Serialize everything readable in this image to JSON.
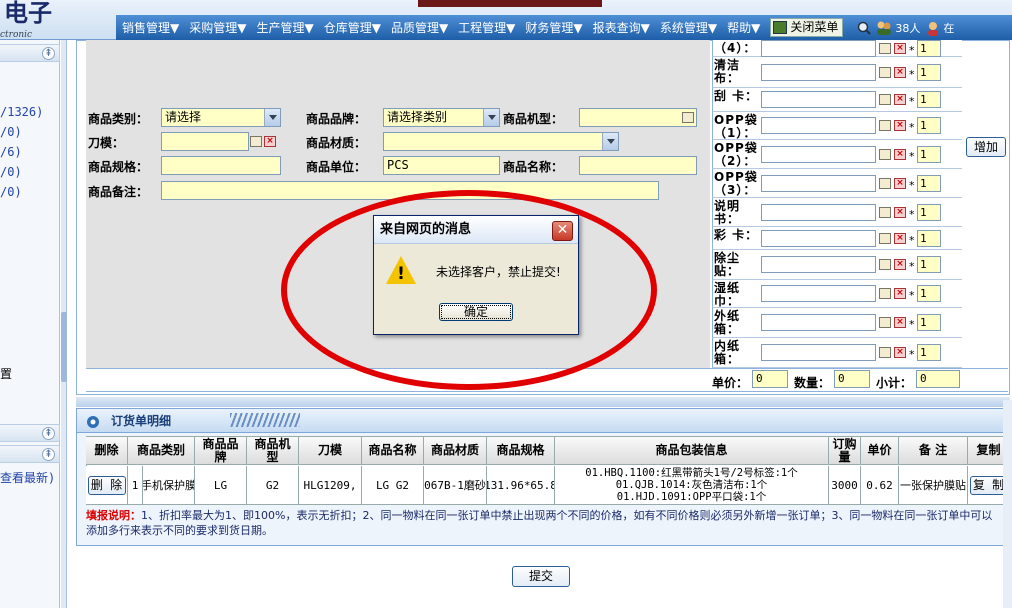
{
  "header": {
    "logo_text": "电子",
    "logo_sub": "ctronic",
    "menu": [
      "销售管理▼",
      "采购管理▼",
      "生产管理▼",
      "仓库管理▼",
      "品质管理▼",
      "工程管理▼",
      "财务管理▼",
      "报表查询▼",
      "系统管理▼",
      "帮助▼"
    ],
    "close_menu_label": "关闭菜单",
    "online_count": "38人",
    "user_fragment": "在"
  },
  "left_panel": {
    "items": [
      "/1326)",
      "/0)",
      "/6)",
      "/0)",
      "/0)"
    ],
    "item_label": "置",
    "bottom_text": "查看最新)"
  },
  "form": {
    "category_label": "商品类别：",
    "category_value": "请选择",
    "brand_label": "商品品牌：",
    "brand_value": "请选择类别",
    "model_label": "商品机型：",
    "model_value": "",
    "die_label": "刀模：",
    "die_value": "",
    "material_label": "商品材质：",
    "material_value": "",
    "spec_label": "商品规格：",
    "spec_value": "",
    "unit_label": "商品单位：",
    "unit_value": "PCS",
    "name_label": "商品名称：",
    "name_value": "",
    "remark_label": "商品备注：",
    "remark_value": ""
  },
  "packaging": {
    "items": [
      {
        "label": "（4）：",
        "qty": "1"
      },
      {
        "label": "清洁布：",
        "qty": "1"
      },
      {
        "label": "刮 卡：",
        "qty": "1"
      },
      {
        "label": "OPP袋（1）：",
        "qty": "1"
      },
      {
        "label": "OPP袋（2）：",
        "qty": "1"
      },
      {
        "label": "OPP袋（3）：",
        "qty": "1"
      },
      {
        "label": "说明书：",
        "qty": "1"
      },
      {
        "label": "彩 卡：",
        "qty": "1"
      },
      {
        "label": "除尘贴：",
        "qty": "1"
      },
      {
        "label": "湿纸巾：",
        "qty": "1"
      },
      {
        "label": "外纸箱：",
        "qty": "1"
      },
      {
        "label": "内纸箱：",
        "qty": "1"
      }
    ],
    "star": "*",
    "add_button": "增加"
  },
  "totals": {
    "unit_price_label": "单价：",
    "unit_price_value": "0",
    "quantity_label": "数量：",
    "quantity_value": "0",
    "subtotal_label": "小计：",
    "subtotal_value": "0"
  },
  "dialog": {
    "title": "来自网页的消息",
    "message": "未选择客户，禁止提交!",
    "ok_button": "确定",
    "close_symbol": "✕"
  },
  "detail": {
    "title": "订货单明细",
    "columns": [
      "删除",
      "商品类别",
      "商品品牌",
      "商品机型",
      "刀模",
      "商品名称",
      "商品材质",
      "商品规格",
      "商品包装信息",
      "订购量",
      "单价",
      "备  注",
      "复制"
    ],
    "row": {
      "delete_button": "删 除",
      "index": "1",
      "category": "手机保护膜",
      "brand": "LG",
      "model": "G2",
      "die": "HLG1209,",
      "name": "LG G2",
      "material": "067B-1磨砂",
      "spec": "131.96*65.8",
      "packaging_lines": [
        "01.HBQ.1100:红黑带箭头1号/2号标签:1个",
        "01.QJB.1014:灰色清洁布:1个",
        "01.HJD.1091:OPP平口袋:1个"
      ],
      "quantity": "3000",
      "price": "0.62",
      "remark": "一张保护膜贴",
      "copy_button": "复 制"
    },
    "note_title": "填报说明：",
    "note_text": "1、折扣率最大为1、即100%，表示无折扣；2、同一物料在同一张订单中禁止出现两个不同的价格，如有不同价格则必须另外新增一张订单；3、同一物料在同一张订单中可以添加多行来表示不同的要求到货日期。"
  },
  "submit_button": "提交"
}
